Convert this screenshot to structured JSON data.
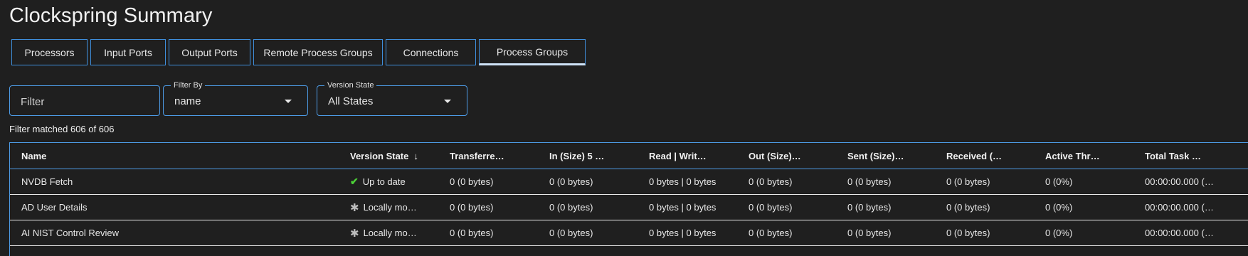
{
  "page": {
    "title": "Clockspring Summary"
  },
  "tabs": [
    {
      "label": "Processors"
    },
    {
      "label": "Input Ports"
    },
    {
      "label": "Output Ports"
    },
    {
      "label": "Remote Process Groups"
    },
    {
      "label": "Connections"
    },
    {
      "label": "Process Groups",
      "active": true
    }
  ],
  "filter": {
    "placeholder": "Filter"
  },
  "filter_by": {
    "legend": "Filter By",
    "value": "name"
  },
  "version_state": {
    "legend": "Version State",
    "value": "All States"
  },
  "matched_text": "Filter matched 606 of 606",
  "table": {
    "columns": [
      {
        "label": "Name"
      },
      {
        "label": "Version State",
        "sort_icon": "arrow-down-icon"
      },
      {
        "label": "Transferre…"
      },
      {
        "label": "In (Size) 5 …"
      },
      {
        "label": "Read | Writ…"
      },
      {
        "label": "Out (Size)…"
      },
      {
        "label": "Sent (Size)…"
      },
      {
        "label": "Received (…"
      },
      {
        "label": "Active Thr…"
      },
      {
        "label": "Total Task …"
      }
    ],
    "rows": [
      {
        "name": "NVDB Fetch",
        "version_icon": "check-icon",
        "version": "Up to date",
        "transferred": "0 (0 bytes)",
        "in": "0 (0 bytes)",
        "read_write": "0 bytes | 0 bytes",
        "out": "0 (0 bytes)",
        "sent": "0 (0 bytes)",
        "received": "0 (0 bytes)",
        "active": "0 (0%)",
        "total_task": "00:00:00.000 (…"
      },
      {
        "name": "AD User Details",
        "version_icon": "asterisk-icon",
        "version": "Locally mo…",
        "transferred": "0 (0 bytes)",
        "in": "0 (0 bytes)",
        "read_write": "0 bytes | 0 bytes",
        "out": "0 (0 bytes)",
        "sent": "0 (0 bytes)",
        "received": "0 (0 bytes)",
        "active": "0 (0%)",
        "total_task": "00:00:00.000 (…"
      },
      {
        "name": "AI NIST Control Review",
        "version_icon": "asterisk-icon",
        "version": "Locally mo…",
        "transferred": "0 (0 bytes)",
        "in": "0 (0 bytes)",
        "read_write": "0 bytes | 0 bytes",
        "out": "0 (0 bytes)",
        "sent": "0 (0 bytes)",
        "received": "0 (0 bytes)",
        "active": "0 (0%)",
        "total_task": "00:00:00.000 (…"
      }
    ]
  },
  "colors": {
    "accent": "#4d9be6",
    "background": "#1f1f1f",
    "check": "#4cd137"
  }
}
